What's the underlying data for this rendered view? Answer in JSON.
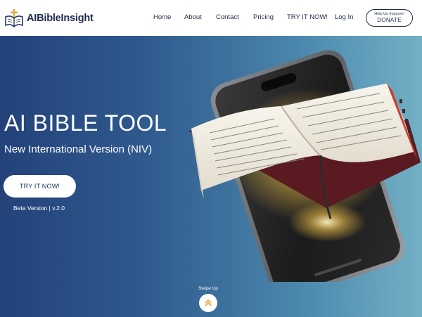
{
  "brand": {
    "name": "AIBibleInsight"
  },
  "nav": {
    "items": [
      {
        "label": "Home"
      },
      {
        "label": "About"
      },
      {
        "label": "Contact"
      },
      {
        "label": "Pricing"
      },
      {
        "label": "TRY IT NOW!"
      },
      {
        "label": "Log In"
      }
    ],
    "donate_small": "Help Us Improve!",
    "donate_label": "DONATE"
  },
  "hero": {
    "title": "AI BIBLE TOOL",
    "subtitle": "New International Version (NIV)",
    "cta_label": "TRY IT NOW!",
    "beta": "Beta Version | v.2.0"
  },
  "swipe": {
    "label": "Swipe Up"
  },
  "colors": {
    "brand_navy": "#1d2b4f",
    "accent_gold": "#e8a83a",
    "hero_start": "#23427a",
    "hero_end": "#73b0c6"
  },
  "icons": {
    "logo": "book-cross-icon",
    "swipe": "double-chevron-up-icon"
  }
}
